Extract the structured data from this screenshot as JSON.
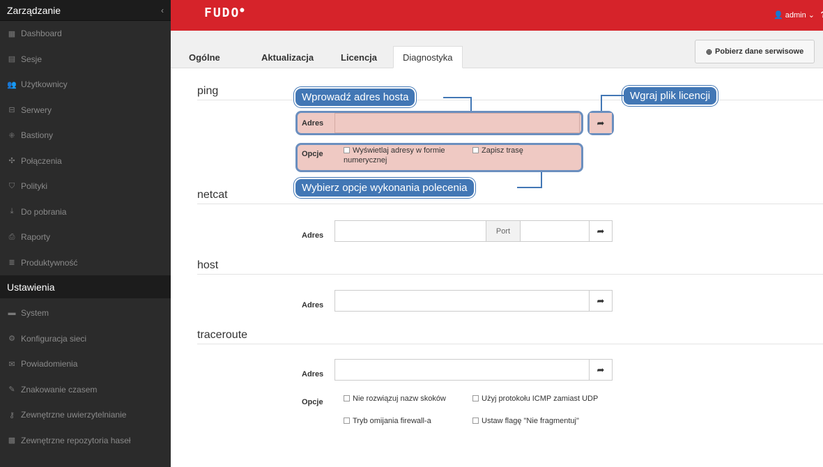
{
  "sidebar": {
    "header": "Zarządzanie",
    "collapse_icon": "‹",
    "items": [
      {
        "label": "Dashboard",
        "icon": "▦"
      },
      {
        "label": "Sesje",
        "icon": "▤"
      },
      {
        "label": "Użytkownicy",
        "icon": "👥"
      },
      {
        "label": "Serwery",
        "icon": "⊟"
      },
      {
        "label": "Bastiony",
        "icon": "⁜"
      },
      {
        "label": "Połączenia",
        "icon": "✣"
      },
      {
        "label": "Polityki",
        "icon": "⛉"
      },
      {
        "label": "Do pobrania",
        "icon": "⤓"
      },
      {
        "label": "Raporty",
        "icon": "⎙"
      },
      {
        "label": "Produktywność",
        "icon": "≣"
      }
    ],
    "section": "Ustawienia",
    "settings_items": [
      {
        "label": "System",
        "icon": "▬"
      },
      {
        "label": "Konfiguracja sieci",
        "icon": "⚙"
      },
      {
        "label": "Powiadomienia",
        "icon": "✉"
      },
      {
        "label": "Znakowanie czasem",
        "icon": "✎"
      },
      {
        "label": "Zewnętrzne uwierzytelnianie",
        "icon": "⚷"
      },
      {
        "label": "Zewnętrzne repozytoria haseł",
        "icon": "▩"
      }
    ]
  },
  "topbar": {
    "logo": "FUDO",
    "user": "admin",
    "help": "?",
    "color": "#d6232a"
  },
  "tabs": [
    {
      "label": "Ogólne"
    },
    {
      "label": "Aktualizacja"
    },
    {
      "label": "Licencja"
    },
    {
      "label": "Diagnostyka"
    }
  ],
  "service_button": "Pobierz dane serwisowe",
  "ping": {
    "title": "ping",
    "address_label": "Adres",
    "options_label": "Opcje",
    "opt1": "Wyświetlaj adresy w formie numerycznej",
    "opt2": "Zapisz trasę"
  },
  "netcat": {
    "title": "netcat",
    "address_label": "Adres",
    "port_label": "Port"
  },
  "host": {
    "title": "host",
    "address_label": "Adres"
  },
  "traceroute": {
    "title": "traceroute",
    "address_label": "Adres",
    "options_label": "Opcje",
    "opt1": "Nie rozwiązuj nazw skoków",
    "opt2": "Użyj protokołu ICMP zamiast UDP",
    "opt3": "Tryb omijania firewall-a",
    "opt4": "Ustaw flagę \"Nie fragmentuj\""
  },
  "callouts": {
    "host_address": "Wprowadź adres hosta",
    "license": "Wgraj plik licencji",
    "options": "Wybierz opcje wykonania polecenia"
  }
}
